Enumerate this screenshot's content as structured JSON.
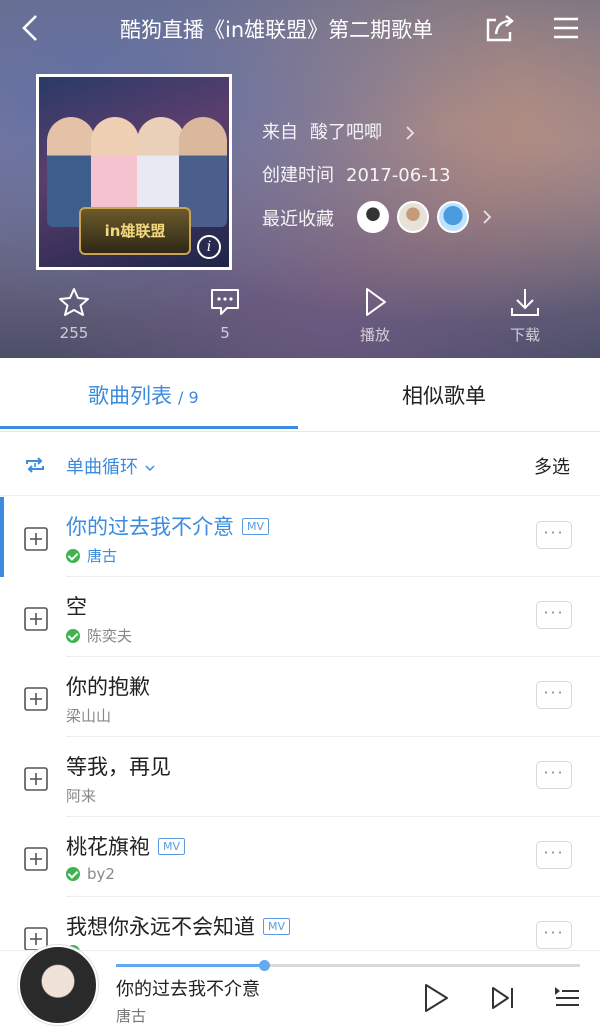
{
  "header": {
    "title": "酷狗直播《in雄联盟》第二期歌单",
    "from_label": "来自",
    "from_user": "酸了吧唧",
    "created_label": "创建时间",
    "created_date": "2017-06-13",
    "collect_label": "最近收藏"
  },
  "cover": {
    "badge_text": "in雄联盟",
    "info_glyph": "i"
  },
  "actions": {
    "favorite_count": "255",
    "comment_count": "5",
    "play_label": "播放",
    "download_label": "下载"
  },
  "tabs": {
    "songs_label": "歌曲列表",
    "songs_count": "/ 9",
    "similar_label": "相似歌单"
  },
  "playmode": {
    "label": "单曲循环",
    "multi_select": "多选"
  },
  "songs": [
    {
      "name": "你的过去我不介意",
      "artist": "唐古",
      "mv": "MV",
      "active": true,
      "downloaded": true
    },
    {
      "name": "空",
      "artist": "陈奕夫",
      "mv": "",
      "active": false,
      "downloaded": true
    },
    {
      "name": "你的抱歉",
      "artist": "梁山山",
      "mv": "",
      "active": false,
      "downloaded": false
    },
    {
      "name": "等我，再见",
      "artist": "阿来",
      "mv": "",
      "active": false,
      "downloaded": false
    },
    {
      "name": "桃花旗袍",
      "artist": "by2",
      "mv": "MV",
      "active": false,
      "downloaded": true
    },
    {
      "name": "我想你永远不会知道",
      "artist": "",
      "mv": "MV",
      "active": false,
      "downloaded": true
    }
  ],
  "more_glyph": "···",
  "player": {
    "title": "你的过去我不介意",
    "artist": "唐古",
    "progress": 0.32
  },
  "colors": {
    "accent": "#3b8be0",
    "download_check": "#3fb34f"
  }
}
